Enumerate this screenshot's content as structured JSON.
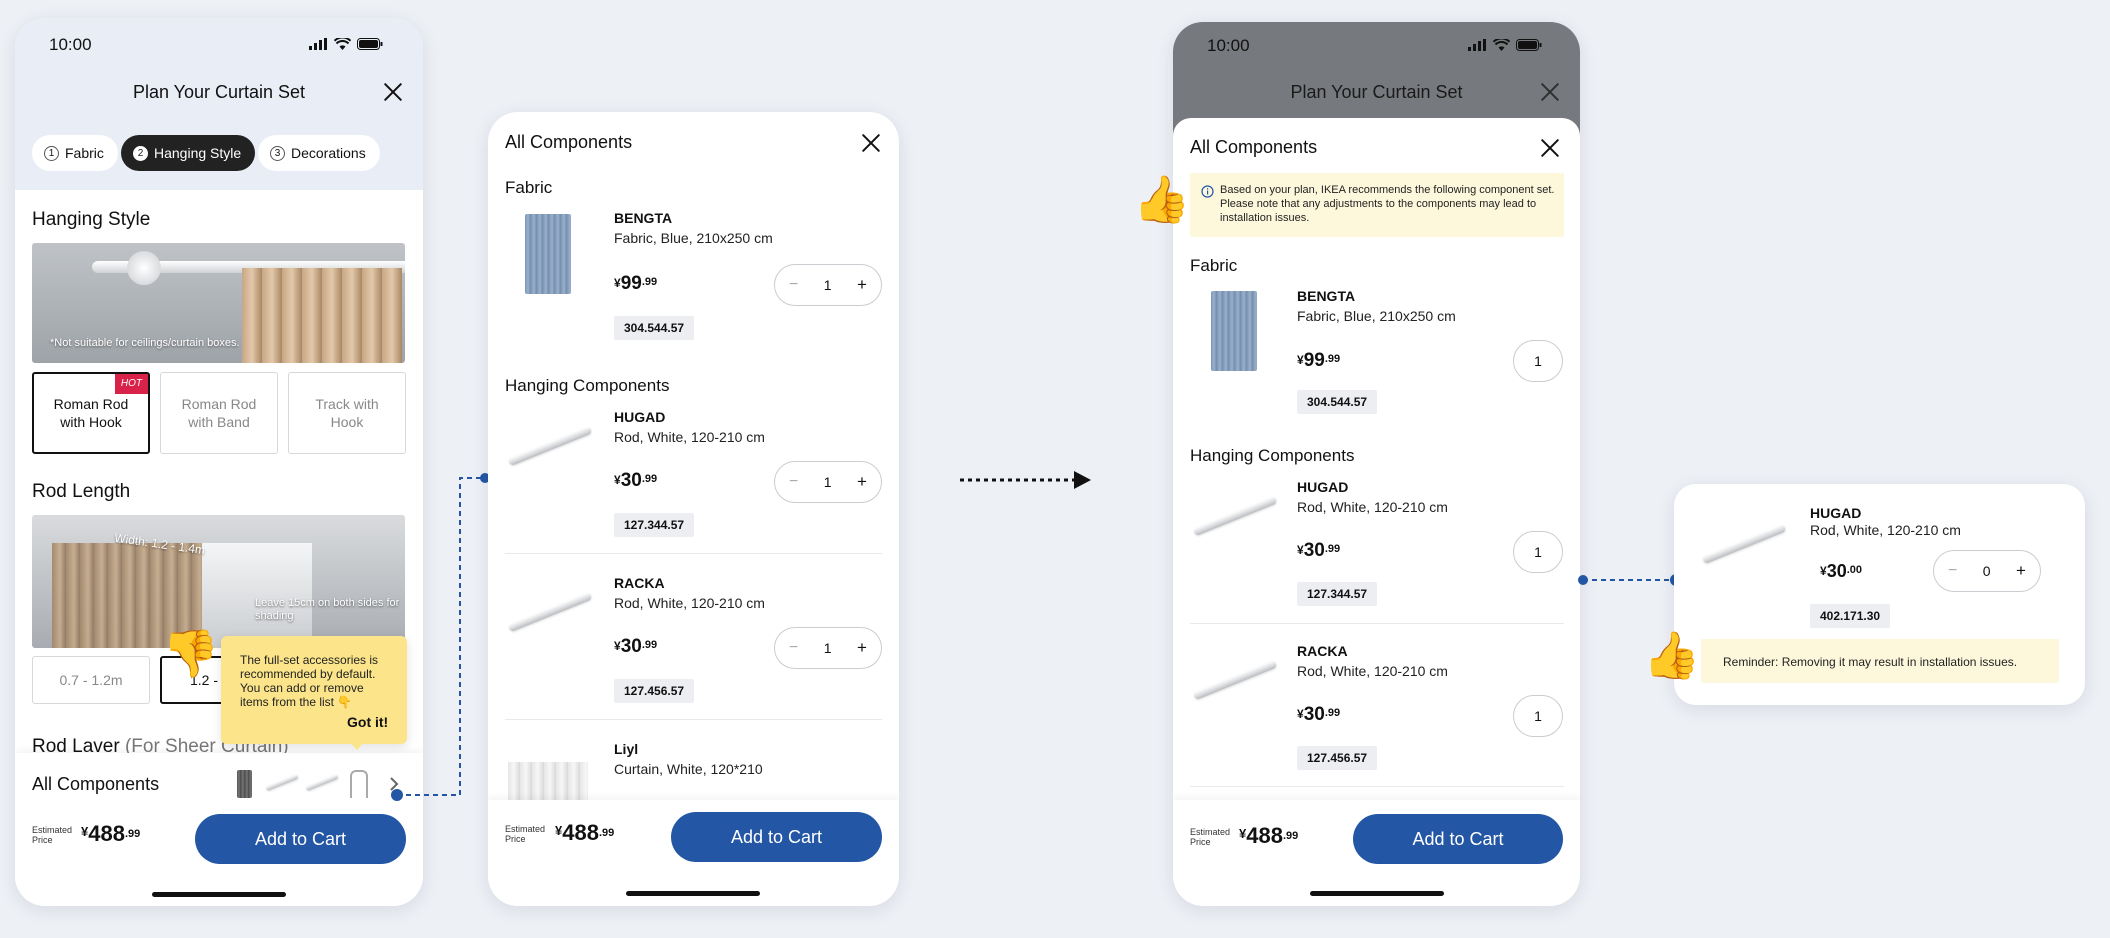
{
  "phone1": {
    "status_time": "10:00",
    "title": "Plan Your Curtain Set",
    "tabs": [
      {
        "num": "1",
        "label": "Fabric"
      },
      {
        "num": "2",
        "label": "Hanging Style"
      },
      {
        "num": "3",
        "label": "Decorations"
      }
    ],
    "hanging_style": {
      "heading": "Hanging Style",
      "photo_note": "*Not suitable for ceilings/curtain boxes.",
      "options": [
        "Roman Rod with Hook",
        "Roman Rod with Band",
        "Track with Hook"
      ],
      "hot_badge": "HOT"
    },
    "rod_length": {
      "heading": "Rod Length",
      "width_label": "Width: 1.2 - 1.4m",
      "side_note": "Leave 15cm on both sides for shading",
      "options": [
        "0.7 - 1.2m",
        "1.2 - 1"
      ]
    },
    "tooltip": {
      "text": "The full-set accessories is recommended by default. You can add or remove items from the list 👇",
      "action": "Got it!"
    },
    "rod_layer": {
      "heading": "Rod Laver",
      "sub": "(For Sheer Curtain)"
    },
    "all_components": "All Components",
    "estimated_label": "Estimated Price",
    "price_currency": "¥",
    "price_int": "488",
    "price_dec": ".99",
    "add_to_cart": "Add to Cart"
  },
  "phone2": {
    "title": "All Components",
    "fabric_heading": "Fabric",
    "hanging_heading": "Hanging Components",
    "items": [
      {
        "name": "BENGTA",
        "desc": "Fabric, Blue, 210x250 cm",
        "price_int": "99",
        "price_dec": ".99",
        "qty": "1",
        "article": "304.544.57"
      },
      {
        "name": "HUGAD",
        "desc": "Rod, White, 120-210 cm",
        "price_int": "30",
        "price_dec": ".99",
        "qty": "1",
        "article": "127.344.57"
      },
      {
        "name": "RACKA",
        "desc": "Rod, White, 120-210 cm",
        "price_int": "30",
        "price_dec": ".99",
        "qty": "1",
        "article": "127.456.57"
      },
      {
        "name": "Liyl",
        "desc": "Curtain, White, 120*210"
      }
    ],
    "estimated_label": "Estimated Price",
    "price_currency": "¥",
    "price_int": "488",
    "price_dec": ".99",
    "add_to_cart": "Add to Cart"
  },
  "phone3": {
    "status_time": "10:00",
    "bg_title": "Plan Your Curtain Set",
    "title": "All Components",
    "info": "Based on your plan, IKEA recommends the following component set. Please note that any adjustments to the components may lead to installation issues.",
    "fabric_heading": "Fabric",
    "hanging_heading": "Hanging Components",
    "items": [
      {
        "name": "BENGTA",
        "desc": "Fabric, Blue, 210x250 cm",
        "price_int": "99",
        "price_dec": ".99",
        "qty": "1",
        "article": "304.544.57"
      },
      {
        "name": "HUGAD",
        "desc": "Rod, White, 120-210 cm",
        "price_int": "30",
        "price_dec": ".99",
        "qty": "1",
        "article": "127.344.57"
      },
      {
        "name": "RACKA",
        "desc": "Rod, White, 120-210 cm",
        "price_int": "30",
        "price_dec": ".99",
        "qty": "1",
        "article": "127.456.57"
      }
    ],
    "estimated_label": "Estimated Price",
    "price_currency": "¥",
    "price_int": "488",
    "price_dec": ".99",
    "add_to_cart": "Add to Cart"
  },
  "card": {
    "name": "HUGAD",
    "desc": "Rod, White, 120-210 cm",
    "price_currency": "¥",
    "price_int": "30",
    "price_dec": ".00",
    "qty": "0",
    "article": "402.171.30",
    "reminder": "Reminder: Removing it may result in installation issues."
  },
  "colors": {
    "brand_blue": "#2356a4",
    "hot_red": "#d9224a",
    "tooltip_yellow": "#fbe48a",
    "info_bg": "#fdf8dc",
    "connector_blue": "#2356a4"
  },
  "icons": [
    "signal-icon",
    "wifi-icon",
    "battery-icon",
    "close-icon",
    "chevron-right-icon",
    "info-icon",
    "thumbs-up-icon",
    "thumbs-down-icon",
    "arrow-right-icon"
  ]
}
